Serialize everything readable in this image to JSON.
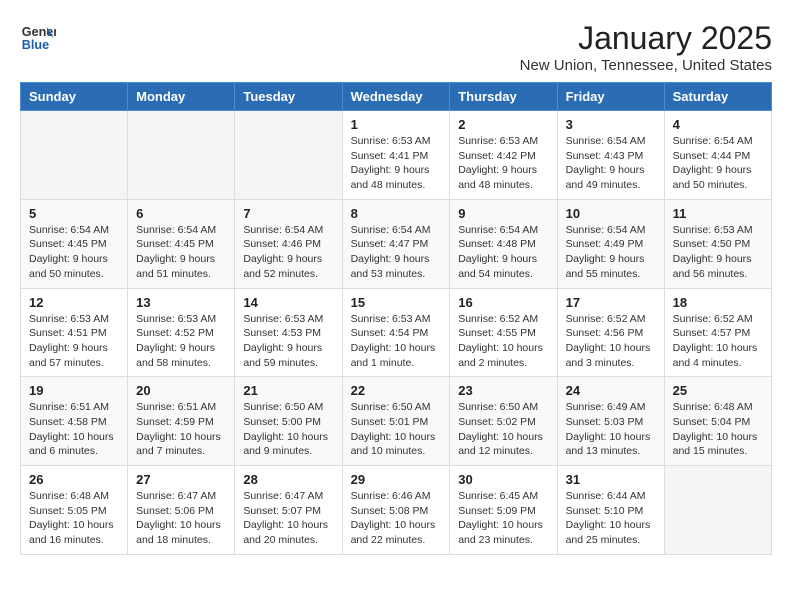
{
  "header": {
    "logo_general": "General",
    "logo_blue": "Blue",
    "month_year": "January 2025",
    "location": "New Union, Tennessee, United States"
  },
  "days_of_week": [
    "Sunday",
    "Monday",
    "Tuesday",
    "Wednesday",
    "Thursday",
    "Friday",
    "Saturday"
  ],
  "weeks": [
    [
      {
        "day": "",
        "info": ""
      },
      {
        "day": "",
        "info": ""
      },
      {
        "day": "",
        "info": ""
      },
      {
        "day": "1",
        "info": "Sunrise: 6:53 AM\nSunset: 4:41 PM\nDaylight: 9 hours and 48 minutes."
      },
      {
        "day": "2",
        "info": "Sunrise: 6:53 AM\nSunset: 4:42 PM\nDaylight: 9 hours and 48 minutes."
      },
      {
        "day": "3",
        "info": "Sunrise: 6:54 AM\nSunset: 4:43 PM\nDaylight: 9 hours and 49 minutes."
      },
      {
        "day": "4",
        "info": "Sunrise: 6:54 AM\nSunset: 4:44 PM\nDaylight: 9 hours and 50 minutes."
      }
    ],
    [
      {
        "day": "5",
        "info": "Sunrise: 6:54 AM\nSunset: 4:45 PM\nDaylight: 9 hours and 50 minutes."
      },
      {
        "day": "6",
        "info": "Sunrise: 6:54 AM\nSunset: 4:45 PM\nDaylight: 9 hours and 51 minutes."
      },
      {
        "day": "7",
        "info": "Sunrise: 6:54 AM\nSunset: 4:46 PM\nDaylight: 9 hours and 52 minutes."
      },
      {
        "day": "8",
        "info": "Sunrise: 6:54 AM\nSunset: 4:47 PM\nDaylight: 9 hours and 53 minutes."
      },
      {
        "day": "9",
        "info": "Sunrise: 6:54 AM\nSunset: 4:48 PM\nDaylight: 9 hours and 54 minutes."
      },
      {
        "day": "10",
        "info": "Sunrise: 6:54 AM\nSunset: 4:49 PM\nDaylight: 9 hours and 55 minutes."
      },
      {
        "day": "11",
        "info": "Sunrise: 6:53 AM\nSunset: 4:50 PM\nDaylight: 9 hours and 56 minutes."
      }
    ],
    [
      {
        "day": "12",
        "info": "Sunrise: 6:53 AM\nSunset: 4:51 PM\nDaylight: 9 hours and 57 minutes."
      },
      {
        "day": "13",
        "info": "Sunrise: 6:53 AM\nSunset: 4:52 PM\nDaylight: 9 hours and 58 minutes."
      },
      {
        "day": "14",
        "info": "Sunrise: 6:53 AM\nSunset: 4:53 PM\nDaylight: 9 hours and 59 minutes."
      },
      {
        "day": "15",
        "info": "Sunrise: 6:53 AM\nSunset: 4:54 PM\nDaylight: 10 hours and 1 minute."
      },
      {
        "day": "16",
        "info": "Sunrise: 6:52 AM\nSunset: 4:55 PM\nDaylight: 10 hours and 2 minutes."
      },
      {
        "day": "17",
        "info": "Sunrise: 6:52 AM\nSunset: 4:56 PM\nDaylight: 10 hours and 3 minutes."
      },
      {
        "day": "18",
        "info": "Sunrise: 6:52 AM\nSunset: 4:57 PM\nDaylight: 10 hours and 4 minutes."
      }
    ],
    [
      {
        "day": "19",
        "info": "Sunrise: 6:51 AM\nSunset: 4:58 PM\nDaylight: 10 hours and 6 minutes."
      },
      {
        "day": "20",
        "info": "Sunrise: 6:51 AM\nSunset: 4:59 PM\nDaylight: 10 hours and 7 minutes."
      },
      {
        "day": "21",
        "info": "Sunrise: 6:50 AM\nSunset: 5:00 PM\nDaylight: 10 hours and 9 minutes."
      },
      {
        "day": "22",
        "info": "Sunrise: 6:50 AM\nSunset: 5:01 PM\nDaylight: 10 hours and 10 minutes."
      },
      {
        "day": "23",
        "info": "Sunrise: 6:50 AM\nSunset: 5:02 PM\nDaylight: 10 hours and 12 minutes."
      },
      {
        "day": "24",
        "info": "Sunrise: 6:49 AM\nSunset: 5:03 PM\nDaylight: 10 hours and 13 minutes."
      },
      {
        "day": "25",
        "info": "Sunrise: 6:48 AM\nSunset: 5:04 PM\nDaylight: 10 hours and 15 minutes."
      }
    ],
    [
      {
        "day": "26",
        "info": "Sunrise: 6:48 AM\nSunset: 5:05 PM\nDaylight: 10 hours and 16 minutes."
      },
      {
        "day": "27",
        "info": "Sunrise: 6:47 AM\nSunset: 5:06 PM\nDaylight: 10 hours and 18 minutes."
      },
      {
        "day": "28",
        "info": "Sunrise: 6:47 AM\nSunset: 5:07 PM\nDaylight: 10 hours and 20 minutes."
      },
      {
        "day": "29",
        "info": "Sunrise: 6:46 AM\nSunset: 5:08 PM\nDaylight: 10 hours and 22 minutes."
      },
      {
        "day": "30",
        "info": "Sunrise: 6:45 AM\nSunset: 5:09 PM\nDaylight: 10 hours and 23 minutes."
      },
      {
        "day": "31",
        "info": "Sunrise: 6:44 AM\nSunset: 5:10 PM\nDaylight: 10 hours and 25 minutes."
      },
      {
        "day": "",
        "info": ""
      }
    ]
  ]
}
